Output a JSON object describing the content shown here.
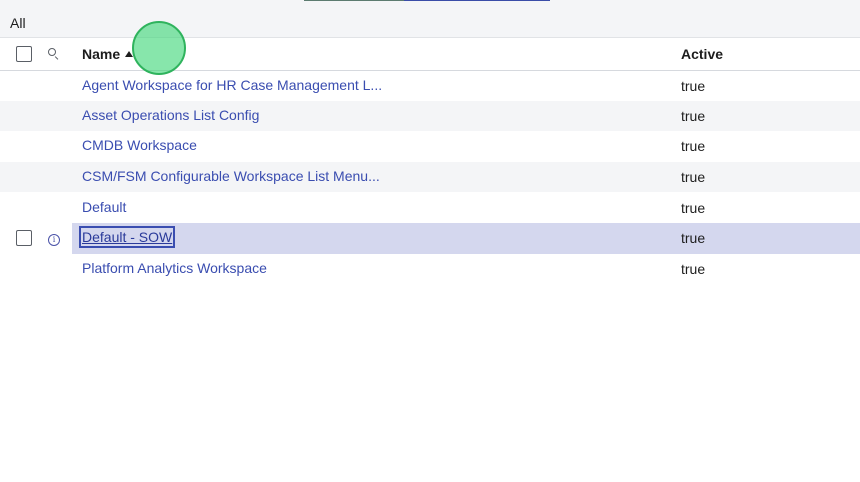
{
  "filter": {
    "breadcrumb": "All"
  },
  "table": {
    "columns": {
      "name": "Name",
      "active": "Active"
    },
    "sort": {
      "column": "Name",
      "direction": "ascending"
    },
    "rows": [
      {
        "name": "Agent Workspace for HR Case Management L...",
        "active": "true"
      },
      {
        "name": "Asset Operations List Config",
        "active": "true"
      },
      {
        "name": "CMDB Workspace",
        "active": "true"
      },
      {
        "name": "CSM/FSM Configurable Workspace List Menu...",
        "active": "true"
      },
      {
        "name": "Default",
        "active": "true"
      },
      {
        "name": "Default - SOW",
        "active": "true",
        "state": "selected"
      },
      {
        "name": "Platform Analytics Workspace",
        "active": "true"
      }
    ]
  },
  "icons": {
    "header_search": "search-icon",
    "row_info": "info-icon",
    "sort": "sort-ascending-icon"
  },
  "colors": {
    "link": "#3a4db0",
    "zebra_row": "#f4f5f7",
    "selected_row": "#d4d7ee",
    "click_indicator": "#3dd678"
  }
}
